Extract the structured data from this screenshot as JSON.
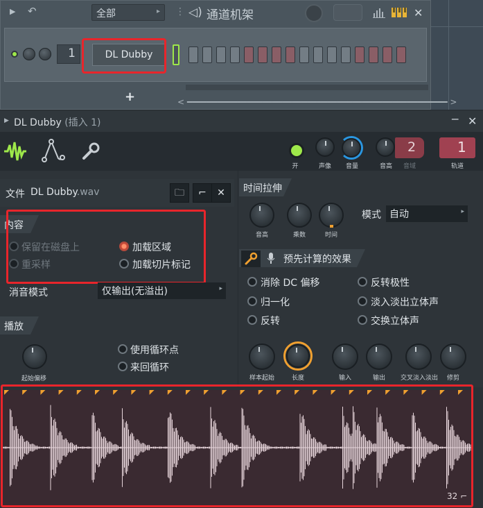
{
  "channel_rack": {
    "filter": "全部",
    "title": "通道机架",
    "channel_number": "1",
    "channel_name": "DL Dubby",
    "add_button": "+",
    "steps": [
      "g",
      "g",
      "g",
      "g",
      "r",
      "r",
      "r",
      "r",
      "g",
      "g",
      "g",
      "g",
      "r",
      "r",
      "r",
      "r"
    ],
    "scroll_arrows": "<  ━━━━━━━━━━━━━━━━━━━━━━━━━━━━━━━━━━━━━━━━━━━━━━━━━━━━  >"
  },
  "window": {
    "title": "DL Dubby",
    "subtitle": "(插入 1)",
    "controls": {
      "on": "开",
      "pan": "声像",
      "volume": "音量",
      "pitch": "音高",
      "range": "音域",
      "range_value": "2",
      "track": "轨道",
      "track_value": "1"
    }
  },
  "file": {
    "label": "文件",
    "name": "DL Dubby",
    "ext": ".wav"
  },
  "content": {
    "heading": "内容",
    "keep_on_disk": "保留在磁盘上",
    "resample": "重采样",
    "load_regions": "加载区域",
    "load_slice_markers": "加载切片标记",
    "declick_label": "消音模式",
    "declick_value": "仅输出(无溢出)"
  },
  "playback": {
    "heading": "播放",
    "start_offset": "起始偏移",
    "use_loop_points": "使用循环点",
    "ping_pong_loop": "来回循环"
  },
  "time_stretch": {
    "heading": "时间拉伸",
    "pitch": "音高",
    "multiply": "乘数",
    "time": "时间",
    "mode_label": "模式",
    "mode_value": "自动"
  },
  "precomputed": {
    "heading": "预先计算的效果",
    "remove_dc": "消除 DC 偏移",
    "normalize": "归一化",
    "reverse": "反转",
    "reverse_polarity": "反转极性",
    "fade_stereo": "淡入淡出立体声",
    "swap_stereo": "交换立体声",
    "knobs": [
      "样本起始",
      "长度",
      "输入",
      "输出",
      "交叉淡入淡出",
      "修剪"
    ]
  },
  "waveform": {
    "zoom": "32 ⌐"
  },
  "colors": {
    "accent_green": "#9ee84a",
    "highlight_red": "#e8252b",
    "volume_blue": "#2a96e0",
    "length_orange": "#f0a030",
    "waveform_bg": "#3a2a31",
    "waveform_fg": "#e8d6dc"
  }
}
